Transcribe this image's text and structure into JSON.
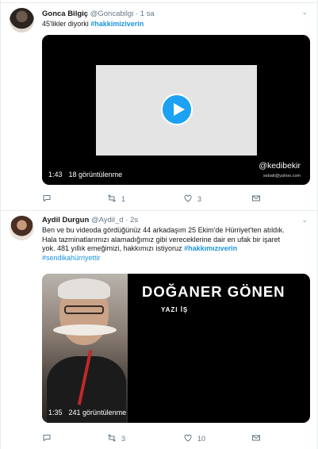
{
  "tweets": [
    {
      "display_name": "Gonca Bilgiç",
      "handle": "@Goncabilgi",
      "separator": "·",
      "time": "1 sa",
      "text": "45'likler diyorki ",
      "hashtag": "#hakkimiziverin",
      "video": {
        "duration": "1:43",
        "views": "18 görüntülenme",
        "watermark": "@kedibekir",
        "watermark_sub": "sebati@yahoo.com"
      },
      "actions": {
        "reply_count": "",
        "retweet_count": "1",
        "like_count": "3"
      }
    },
    {
      "display_name": "Aydil Durgun",
      "handle": "@Aydil_d",
      "separator": "·",
      "time": "2s",
      "text_line_1": "Ben ve bu videoda gördüğünüz 44 arkadaşım 25 Ekim'de Hürriyet'ten atıldık.",
      "text_line_2": "Hala tazminatlarımızı alamadığımız gibi vereceklerine dair en ufak bir işaret",
      "text_line_3": "yok. 481 yıllık emeğimizi, hakkımızı istiyoruz ",
      "hashtag_1": "#hakkımızıverin",
      "hashtag_2": "#sendikahürriyettir",
      "video": {
        "title": "DOĞANER GÖNEN",
        "subtitle": "YAZI İŞ",
        "duration": "1:35",
        "views": "241 görüntülenme"
      },
      "actions": {
        "reply_count": "",
        "retweet_count": "3",
        "like_count": "10"
      }
    }
  ],
  "icons": {
    "reply": "speech-bubble",
    "retweet": "two-arrows-loop",
    "like": "heart-outline",
    "share": "envelope",
    "menu": "chevron-down"
  },
  "colors": {
    "link": "#1b95e0",
    "play_button": "#1da1f2",
    "muted": "#657786"
  }
}
